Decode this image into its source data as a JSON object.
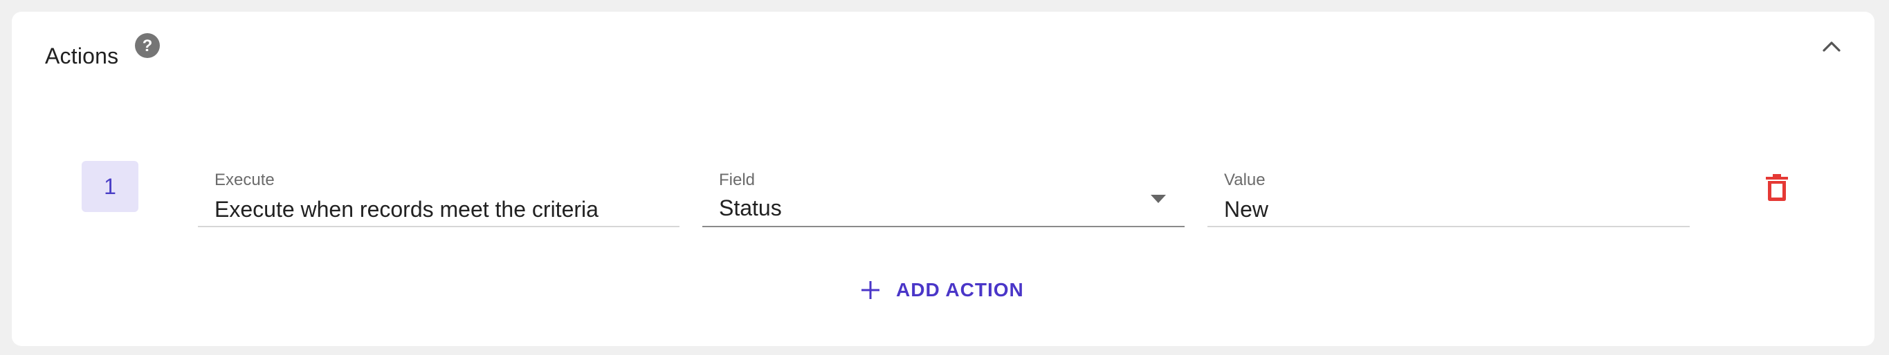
{
  "header": {
    "title": "Actions",
    "help_icon": "question-circle-icon",
    "collapse_icon": "chevron-up-icon"
  },
  "action_row": {
    "step_number": "1",
    "execute": {
      "label": "Execute",
      "value": "Execute when records meet the criteria"
    },
    "field": {
      "label": "Field",
      "value": "Status",
      "icon": "dropdown-arrow-icon"
    },
    "value": {
      "label": "Value",
      "value": "New"
    },
    "delete_icon": "trash-icon"
  },
  "add_action": {
    "label": "ADD ACTION",
    "icon": "plus-icon"
  },
  "colors": {
    "accent": "#4a36c8",
    "badge_bg": "#e6e3f9",
    "delete": "#e53935",
    "help_icon": "#757575"
  }
}
